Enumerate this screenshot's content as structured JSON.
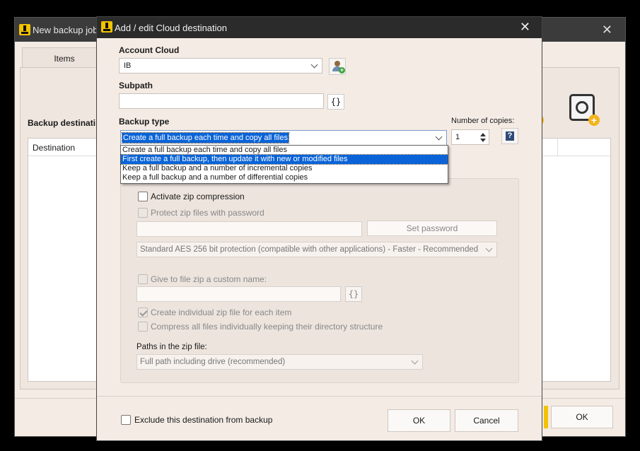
{
  "background_window": {
    "title": "New backup job",
    "tab_items": "Items",
    "backup_destination_label": "Backup destinati",
    "destination_column": "Destination",
    "ok_label": "OK"
  },
  "dialog": {
    "title": "Add / edit Cloud destination",
    "account_cloud": {
      "label": "Account Cloud",
      "selected": "IB"
    },
    "subpath": {
      "label": "Subpath",
      "value": "",
      "brace_label": "{}"
    },
    "backup_type": {
      "label": "Backup type",
      "selected": "Create a full backup each time and copy all files",
      "options": [
        "Create a full backup each time and copy all files",
        "First create a full backup, then update it with new or modified files",
        "Keep a full backup and a number of incremental copies",
        "Keep a full backup and a number of differential copies"
      ],
      "highlighted_index": 1
    },
    "copies": {
      "label": "Number of copies:",
      "value": "1",
      "help": "?"
    },
    "zip": {
      "activate_label": "Activate zip compression",
      "protect_label": "Protect zip files with password",
      "password_value": "",
      "set_password_label": "Set password",
      "encryption_selected": "Standard AES 256 bit protection (compatible with other applications) - Faster - Recommended",
      "custom_name_label": "Give to file zip a custom name:",
      "custom_name_value": "",
      "brace_label": "{}",
      "individual_label": "Create individual zip file for each item",
      "compress_all_label": "Compress all files individually keeping their directory structure",
      "paths_label": "Paths in the zip file:",
      "paths_selected": "Full path including drive (recommended)"
    },
    "exclude_label": "Exclude this destination from backup",
    "ok_label": "OK",
    "cancel_label": "Cancel"
  }
}
